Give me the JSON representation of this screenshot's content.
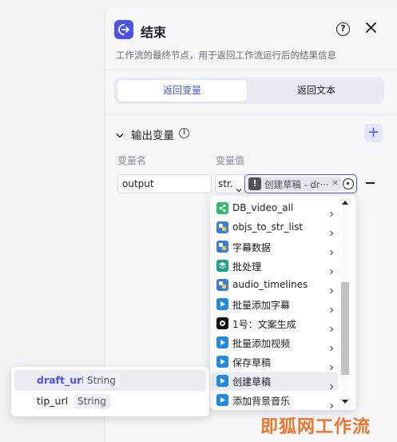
{
  "header": {
    "title": "结束",
    "description": "工作流的最终节点，用于返回工作流运行后的结果信息",
    "help_label": "?"
  },
  "tabs": [
    {
      "label": "返回变量",
      "active": true
    },
    {
      "label": "返回文本",
      "active": false
    }
  ],
  "output_section": {
    "title": "输出变量",
    "info_label": "i",
    "add_label": "+",
    "col_name": "变量名",
    "col_value": "变量值"
  },
  "row": {
    "name_value": "output",
    "type_value": "str.",
    "ref_icon_label": "!",
    "ref_text": "创建草稿 - dr···",
    "ref_close": "×"
  },
  "dropdown": {
    "items": [
      {
        "label": "DB_video_all",
        "icon": "green-flow-icon",
        "color": "#2fba6c"
      },
      {
        "label": "objs_to_str_list",
        "icon": "python-icon",
        "color": "#3b7fd4"
      },
      {
        "label": "字幕数据",
        "icon": "python-icon",
        "color": "#3b7fd4"
      },
      {
        "label": "批处理",
        "icon": "batch-icon",
        "color": "#17a589"
      },
      {
        "label": "audio_timelines",
        "icon": "python-icon",
        "color": "#3b7fd4"
      },
      {
        "label": "批量添加字幕",
        "icon": "plugin-icon",
        "color": "#1f8ae0"
      },
      {
        "label": "1号：文案生成",
        "icon": "llm-icon",
        "color": "#111111"
      },
      {
        "label": "批量添加视频",
        "icon": "plugin-icon",
        "color": "#1f8ae0"
      },
      {
        "label": "保存草稿",
        "icon": "plugin-icon",
        "color": "#1f8ae0"
      },
      {
        "label": "创建草稿",
        "icon": "plugin-icon",
        "color": "#1f8ae0"
      },
      {
        "label": "添加背景音乐",
        "icon": "plugin-icon",
        "color": "#1f8ae0"
      }
    ]
  },
  "submenu": {
    "items": [
      {
        "name": "draft_url",
        "type": "String",
        "selected": true
      },
      {
        "name": "tip_url",
        "type": "String",
        "selected": false
      }
    ]
  },
  "watermark": "即狐网工作流",
  "colors": {
    "accent": "#4d53e8"
  }
}
